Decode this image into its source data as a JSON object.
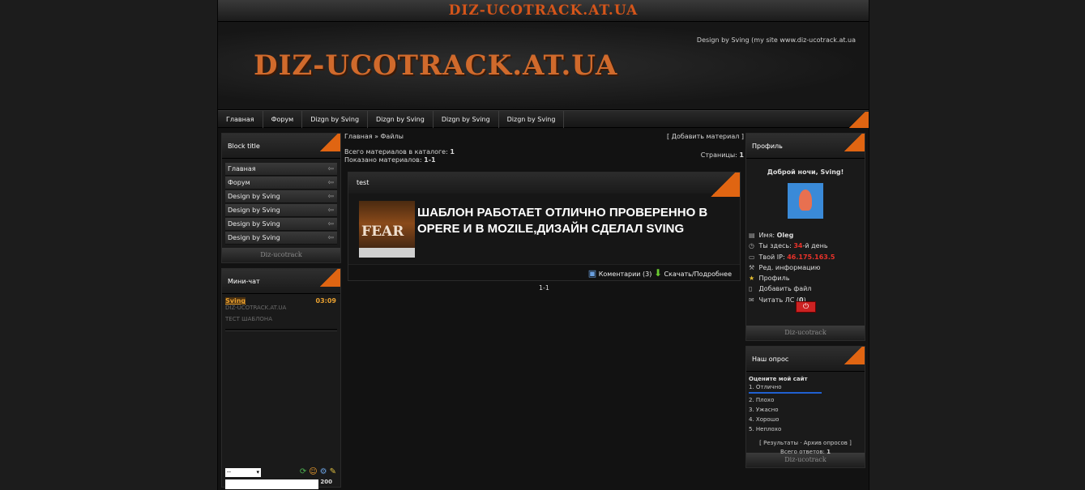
{
  "top_banner": "DIZ-UCOTRACK.AT.UA",
  "header": {
    "logo": "DIZ-UCOTRACK.AT.UA",
    "credit": "Design by Sving (my site www.diz-ucotrack.at.ua"
  },
  "nav": [
    "Главная",
    "Форум",
    "Dizgn by Sving",
    "Dizgn by Sving",
    "Dizgn by Sving",
    "Dizgn by Sving"
  ],
  "left": {
    "block1": {
      "title": "Block title",
      "items": [
        "Главная",
        "Форум",
        "Design by Sving",
        "Design by Sving",
        "Design by Sving",
        "Design by Sving"
      ],
      "footer": "Diz-ucotrack"
    },
    "chat": {
      "title": "Мини-чат",
      "user": "Sving",
      "time": "03:09",
      "line1": "DIZ-UCOTRACK.AT.UA",
      "line2": "ТЕСТ ШАБЛОНА",
      "select": "--",
      "count": "200"
    }
  },
  "center": {
    "breadcrumb": "Главная » Файлы",
    "add": "[ Добавить материал ]",
    "total_label": "Всего материалов в каталоге:",
    "total_value": "1",
    "shown_label": "Показано материалов:",
    "shown_value": "1-1",
    "pages_label": "Страницы:",
    "pages_value": "1",
    "entry": {
      "title": "test",
      "image_text": "FEAR",
      "text": "ШАБЛОН РАБОТАЕТ ОТЛИЧНО ПРОВЕРЕННО В OPERE И В MOZILE,ДИЗАЙН СДЕЛАЛ SVING",
      "comments": "Коментарии (3)",
      "download": "Скачать/Подробнее"
    },
    "pager": "1-1"
  },
  "right": {
    "profile": {
      "title": "Профиль",
      "greeting": "Доброй ночи, Sving!",
      "name_label": "Имя:",
      "name_value": "Oleg",
      "here_label": "Ты здесь:",
      "here_value": "34",
      "here_suffix": "-й день",
      "ip_label": "Твой IP:",
      "ip_value": "46.175.163.5",
      "edit": "Ред. информацию",
      "profile_link": "Профиль",
      "add_file": "Добавить файл",
      "pm_label": "Читать ЛС (",
      "pm_value": "0",
      "pm_end": ")",
      "footer": "Diz-ucotrack"
    },
    "poll": {
      "title": "Наш опрос",
      "question": "Оцените мой сайт",
      "options": [
        "1. Отлично",
        "2. Плохо",
        "3. Ужасно",
        "4. Хорошо",
        "5. Неплохо"
      ],
      "results": "Результаты",
      "archive": "Архив опросов",
      "total_label": "Всего ответов:",
      "total_value": "1",
      "footer": "Diz-ucotrack"
    }
  },
  "colors": {
    "accent": "#e06512",
    "logo": "#d06a2c",
    "ip": "#e8322a"
  }
}
